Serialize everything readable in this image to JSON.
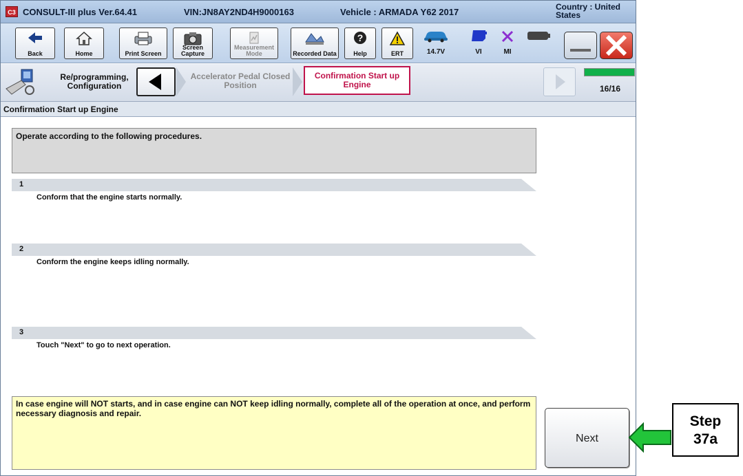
{
  "titlebar": {
    "app_name": "CONSULT-III plus  Ver.64.41",
    "vin": "VIN:JN8AY2ND4H9000163",
    "vehicle": "Vehicle : ARMADA Y62 2017",
    "country": "Country : United States",
    "logo_text": "C3"
  },
  "toolbar": {
    "back": "Back",
    "home": "Home",
    "print_screen": "Print Screen",
    "screen_capture": "Screen Capture",
    "measurement_mode": "Measurement Mode",
    "recorded_data": "Recorded Data",
    "help": "Help",
    "ert": "ERT",
    "voltage": "14.7V",
    "vi": "VI",
    "mi": "MI"
  },
  "nav": {
    "section": "Re/programming, Configuration",
    "prev_step": "Accelerator Pedal Closed Position",
    "current_step": "Confirmation Start up Engine",
    "progress_text": "16/16",
    "progress_fraction": 1.0
  },
  "section_title": "Confirmation Start up Engine",
  "content": {
    "intro": "Operate according to the following procedures.",
    "steps": [
      {
        "num": "1",
        "text": "Conform that the engine starts normally."
      },
      {
        "num": "2",
        "text": "Conform the engine keeps idling normally."
      },
      {
        "num": "3",
        "text": "Touch \"Next\" to go to next operation."
      }
    ],
    "warning": "In case engine will NOT starts, and in case engine can NOT keep idling normally, complete all of the operation at once, and perform necessary diagnosis and repair.",
    "next_label": "Next"
  },
  "annotation": {
    "line1": "Step",
    "line2": "37a",
    "arrow_color": "#22c43a"
  },
  "colors": {
    "current_step_border": "#c0134b",
    "progress": "#11b04a",
    "warning_bg": "#ffffc4"
  }
}
